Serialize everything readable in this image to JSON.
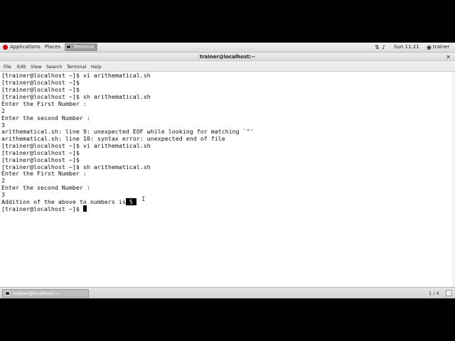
{
  "top_panel": {
    "applications": "Applications",
    "places": "Places",
    "terminal_task": "Terminal",
    "clock": "Sun 11:21",
    "user": "trainer"
  },
  "window": {
    "title": "trainer@localhost:~"
  },
  "menu": [
    "File",
    "Edit",
    "View",
    "Search",
    "Terminal",
    "Help"
  ],
  "terminal": {
    "lines": [
      "[trainer@localhost ~]$ vi arithematical.sh",
      "[trainer@localhost ~]$",
      "[trainer@localhost ~]$",
      "[trainer@localhost ~]$ sh arithematical.sh",
      "Enter the First Number :",
      "2",
      "Enter the second Number :",
      "3",
      "arithematical.sh: line 9: unexpected EOF while looking for matching `\"'",
      "arithematical.sh: line 10: syntax error: unexpected end of file",
      "[trainer@localhost ~]$ vi arithematical.sh",
      "[trainer@localhost ~]$",
      "[trainer@localhost ~]$",
      "[trainer@localhost ~]$ sh arithematical.sh",
      "Enter the First Number :",
      "2",
      "Enter the second Number :",
      "3"
    ],
    "result_prefix": "Addition of the above to numbers is",
    "result_value": " 5 ",
    "prompt": "[trainer@localhost ~]$ "
  },
  "bottom_panel": {
    "task": "trainer@localhost:~",
    "workspace": "1 / 4"
  }
}
